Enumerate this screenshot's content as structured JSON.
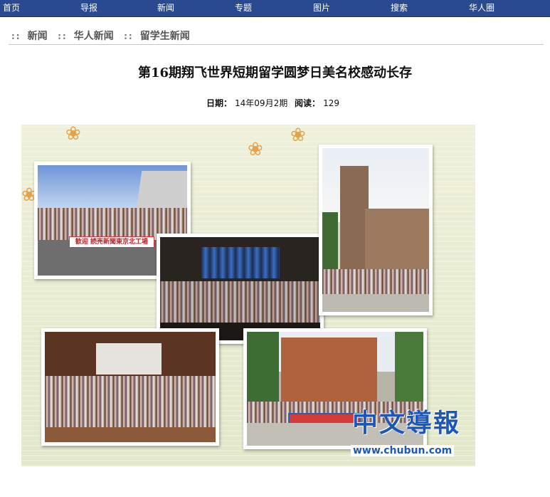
{
  "nav": {
    "items": [
      "首页",
      "导报",
      "新闻",
      "专题",
      "图片",
      "搜索",
      "华人圈"
    ]
  },
  "breadcrumb": {
    "sep": "::",
    "items": [
      "新闻",
      "华人新闻",
      "留学生新闻"
    ]
  },
  "article": {
    "title": "第16期翔飞世界短期留学圆梦日美名校感动长存",
    "date_label": "日期：",
    "date_value": "14年09月2期",
    "read_label": "阅读：",
    "read_value": "129"
  },
  "image": {
    "banner_sign": "歓迎 読売新聞東京北工場",
    "logo_cn": "中文導報",
    "logo_url": "www.chubun.com"
  },
  "colors": {
    "nav_bg": "#2a4a8f",
    "logo_blue": "#1d57b8"
  }
}
